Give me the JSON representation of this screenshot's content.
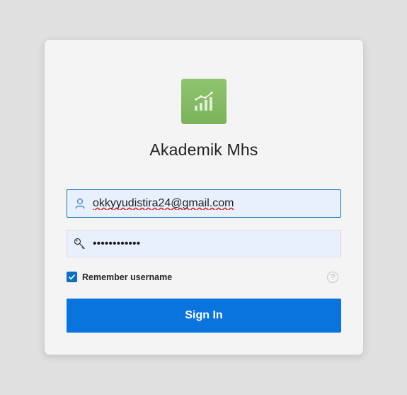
{
  "app": {
    "title": "Akademik Mhs",
    "logo_icon": "bar-chart-trend-icon",
    "logo_color": "#7ab35a"
  },
  "login": {
    "username_value": "okkyyudistira24@gmail.com",
    "username_icon": "user-icon",
    "password_value": "••••••••••••",
    "password_icon": "key-icon",
    "remember_label": "Remember username",
    "remember_checked": true,
    "help_icon": "question-mark-icon",
    "help_symbol": "?",
    "signin_label": "Sign In"
  },
  "colors": {
    "accent": "#0a74de",
    "field_background": "#e8f0fe",
    "page_background": "#e0e0e0"
  }
}
